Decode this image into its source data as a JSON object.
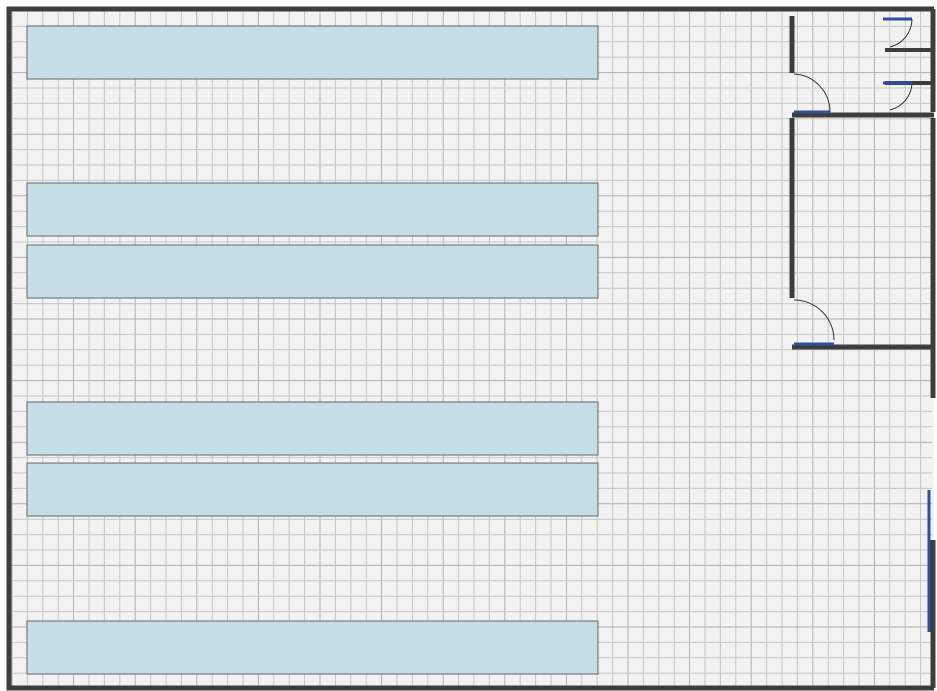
{
  "floor_plan": {
    "colors": {
      "floor": "#f2f2f2",
      "grid_minor": "#c6c6c6",
      "grid_major": "#b0b0b0",
      "wall": "#3d3d3d",
      "wall_outline": "#6d6d6d",
      "desk_fill": "#c4dde6",
      "desk_stroke": "#7a7a7a",
      "door_blue": "#2f4f9a"
    },
    "desks": [
      {
        "name": "desk-row-1"
      },
      {
        "name": "desk-row-2"
      },
      {
        "name": "desk-row-3"
      },
      {
        "name": "desk-row-4"
      },
      {
        "name": "desk-row-5"
      },
      {
        "name": "desk-row-6"
      }
    ],
    "doors": [
      {
        "name": "door-small-room"
      },
      {
        "name": "door-restroom-stall-1"
      },
      {
        "name": "door-restroom-stall-2"
      },
      {
        "name": "door-office-room"
      },
      {
        "name": "door-exterior-upper"
      },
      {
        "name": "door-exterior-lower"
      }
    ]
  }
}
